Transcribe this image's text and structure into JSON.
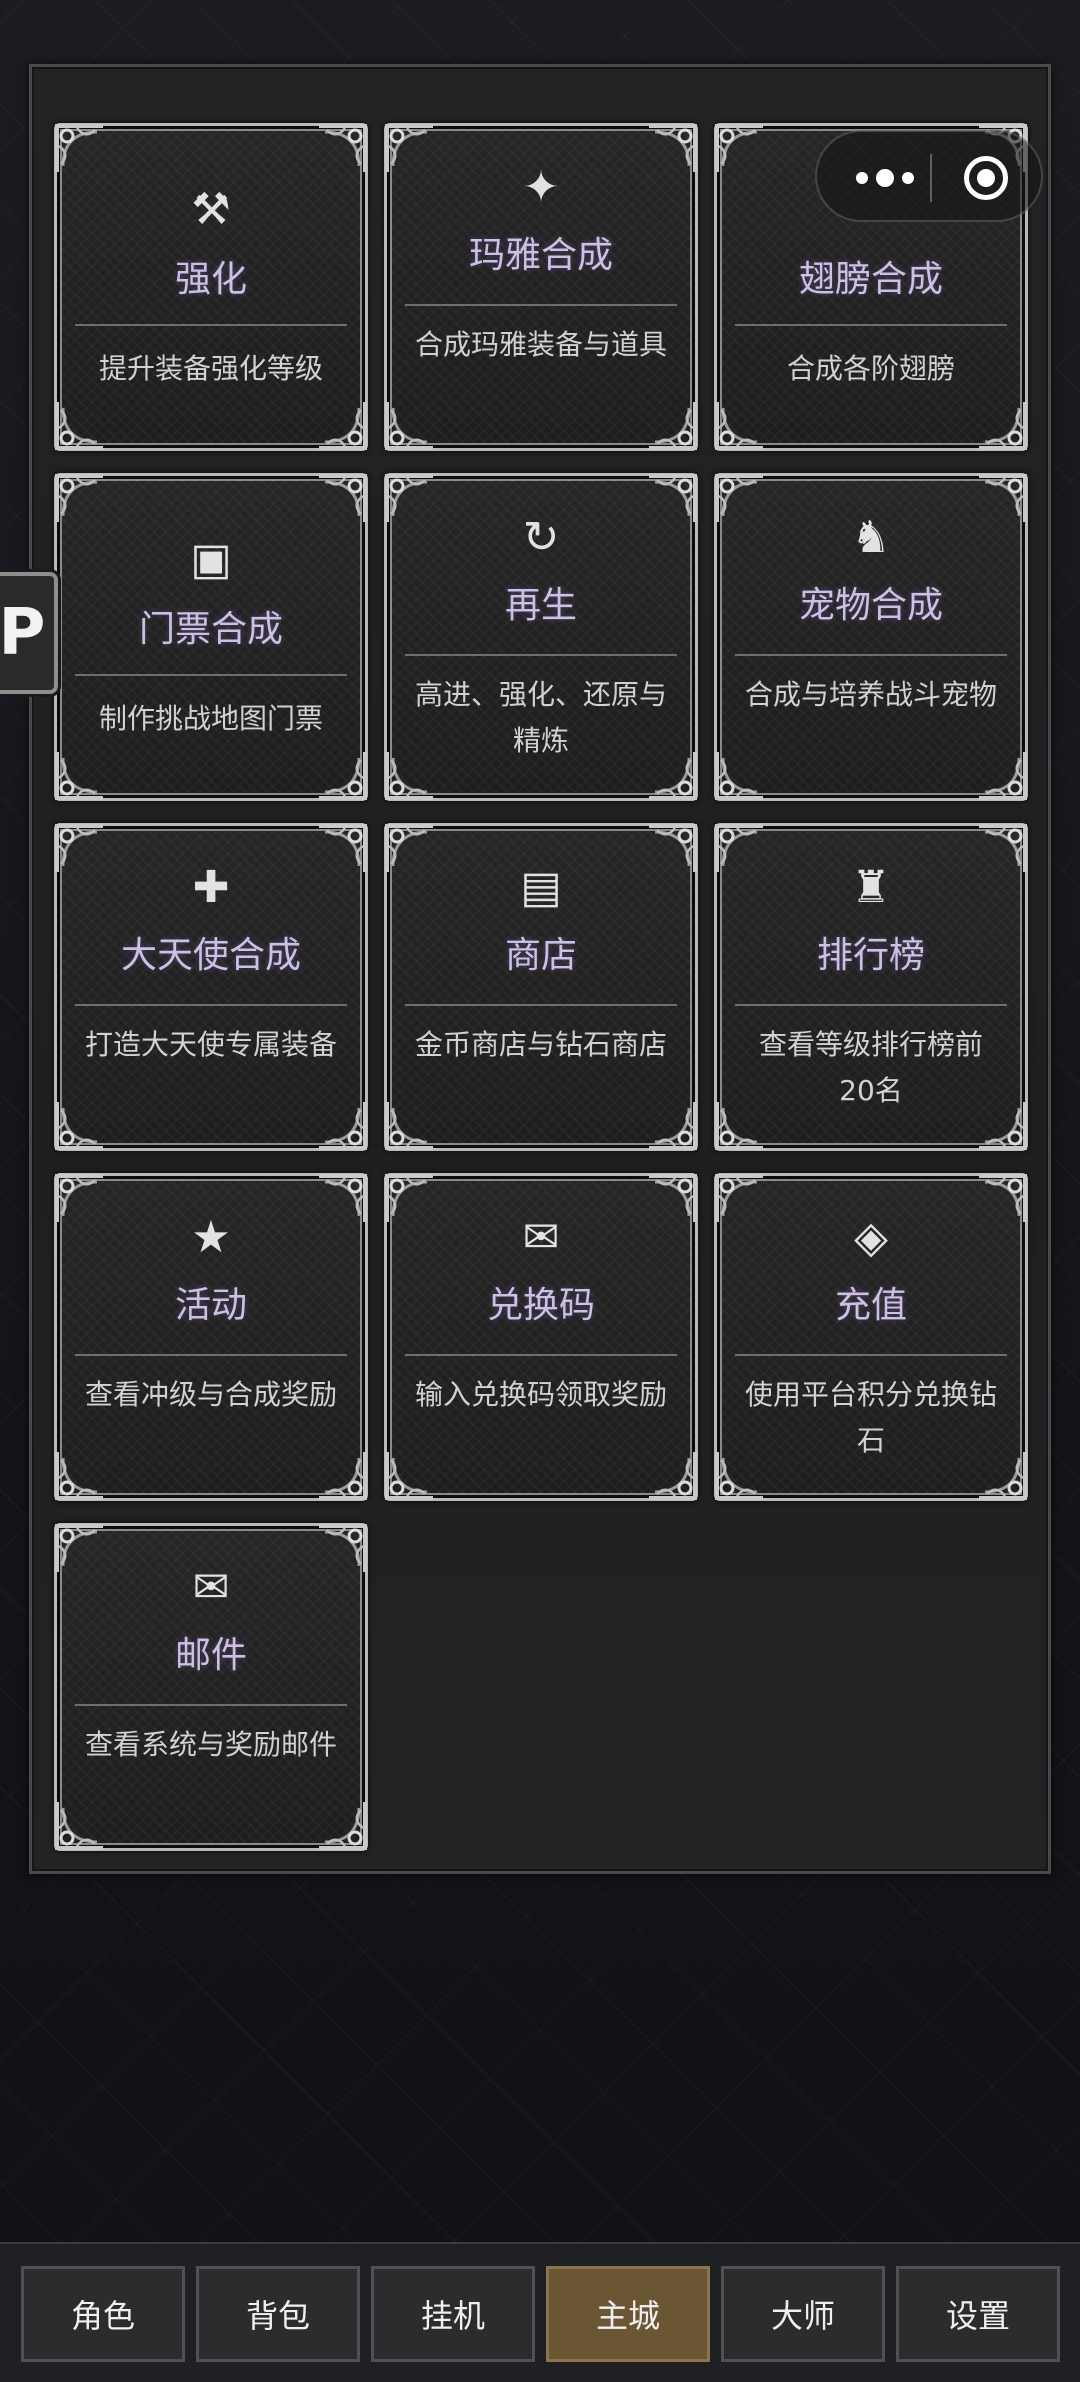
{
  "cards": [
    {
      "icon": "⚒",
      "icon_name": "hammer-icon",
      "title": "强化",
      "desc": "提升装备强化等级"
    },
    {
      "icon": "✦",
      "icon_name": "sparkle-star-icon",
      "title": "玛雅合成",
      "desc": "合成玛雅装备与道具"
    },
    {
      "icon": "",
      "icon_name": "wings-icon",
      "title": "翅膀合成",
      "desc": "合成各阶翅膀"
    },
    {
      "icon": "▣",
      "icon_name": "ticket-icon",
      "title": "门票合成",
      "desc": "制作挑战地图门票"
    },
    {
      "icon": "↻",
      "icon_name": "refresh-icon",
      "title": "再生",
      "desc": "高进、强化、还原与精炼"
    },
    {
      "icon": "♞",
      "icon_name": "horse-icon",
      "title": "宠物合成",
      "desc": "合成与培养战斗宠物"
    },
    {
      "icon": "✚",
      "icon_name": "cross-icon",
      "title": "大天使合成",
      "desc": "打造大天使专属装备"
    },
    {
      "icon": "▤",
      "icon_name": "shop-list-icon",
      "title": "商店",
      "desc": "金币商店与钻石商店"
    },
    {
      "icon": "♜",
      "icon_name": "rook-trophy-icon",
      "title": "排行榜",
      "desc": "查看等级排行榜前20名"
    },
    {
      "icon": "★",
      "icon_name": "star-icon",
      "title": "活动",
      "desc": "查看冲级与合成奖励"
    },
    {
      "icon": "✉",
      "icon_name": "envelope-icon",
      "title": "兑换码",
      "desc": "输入兑换码领取奖励"
    },
    {
      "icon": "◈",
      "icon_name": "diamond-icon",
      "title": "充值",
      "desc": "使用平台积分兑换钻石"
    },
    {
      "icon": "✉",
      "icon_name": "mail-icon",
      "title": "邮件",
      "desc": "查看系统与奖励邮件"
    }
  ],
  "side_tab": {
    "label": "P"
  },
  "nav": [
    {
      "label": "角色",
      "active": false
    },
    {
      "label": "背包",
      "active": false
    },
    {
      "label": "挂机",
      "active": false
    },
    {
      "label": "主城",
      "active": true
    },
    {
      "label": "大师",
      "active": false
    },
    {
      "label": "设置",
      "active": false
    }
  ],
  "colors": {
    "active_tab": "#6b5634",
    "title_text": "#cdbfe6",
    "card_border": "#b9b9b9"
  }
}
